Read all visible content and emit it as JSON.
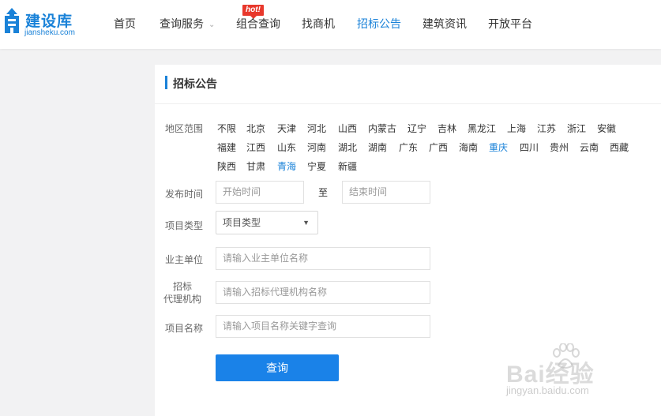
{
  "logo": {
    "name": "建设库",
    "sub": "jiansheku.com"
  },
  "nav": {
    "items": [
      {
        "label": "首页"
      },
      {
        "label": "查询服务",
        "has_dropdown": true
      },
      {
        "label": "组合查询",
        "badge": "hot!"
      },
      {
        "label": "找商机"
      },
      {
        "label": "招标公告",
        "active": true
      },
      {
        "label": "建筑资讯"
      },
      {
        "label": "开放平台"
      }
    ]
  },
  "panel": {
    "title": "招标公告"
  },
  "form": {
    "region_label": "地区范围",
    "regions": [
      "不限",
      "北京",
      "天津",
      "河北",
      "山西",
      "内蒙古",
      "辽宁",
      "吉林",
      "黑龙江",
      "上海",
      "江苏",
      "浙江",
      "安徽",
      "福建",
      "江西",
      "山东",
      "河南",
      "湖北",
      "湖南",
      "广东",
      "广西",
      "海南",
      "重庆",
      "四川",
      "贵州",
      "云南",
      "西藏",
      "陕西",
      "甘肃",
      "青海",
      "宁夏",
      "新疆"
    ],
    "highlighted_regions": [
      "重庆",
      "青海"
    ],
    "publish_time_label": "发布时间",
    "start_placeholder": "开始时间",
    "to_text": "至",
    "end_placeholder": "结束时间",
    "project_type_label": "项目类型",
    "project_type_value": "项目类型",
    "owner_label": "业主单位",
    "owner_placeholder": "请输入业主单位名称",
    "agency_label_1": "招标",
    "agency_label_2": "代理机构",
    "agency_placeholder": "请输入招标代理机构名称",
    "project_name_label": "项目名称",
    "project_name_placeholder": "请输入项目名称关键字查询",
    "submit_label": "查询"
  },
  "watermark": {
    "text": "Bai经验",
    "url": "jingyan.baidu.com"
  },
  "colors": {
    "accent": "#1a82d8",
    "button": "#1a82e8",
    "hot": "#e8382c"
  }
}
